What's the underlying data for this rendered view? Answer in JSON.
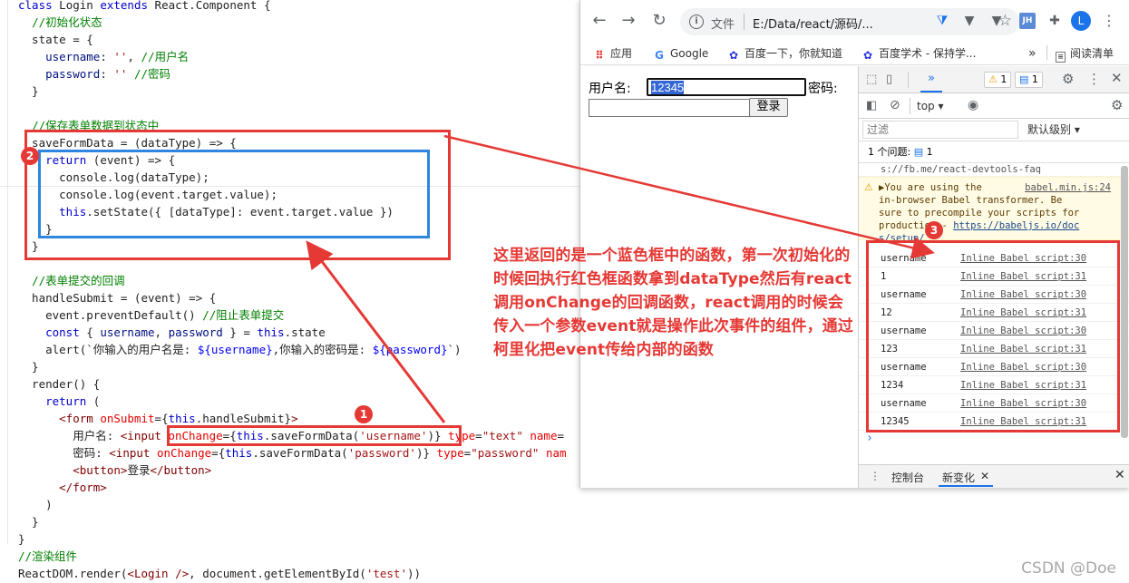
{
  "editor": {
    "lines": [
      {
        "html": "<span class='c-kw'>class</span> Login <span class='c-kw'>extends</span> React.Component {"
      },
      {
        "html": "  <span class='c-cm'>//初始化状态</span>"
      },
      {
        "html": "  state = {"
      },
      {
        "html": "    <span class='c-vr'>username</span>: <span class='c-st'>''</span>, <span class='c-cm'>//用户名</span>"
      },
      {
        "html": "    <span class='c-vr'>password</span>: <span class='c-st'>''</span> <span class='c-cm'>//密码</span>"
      },
      {
        "html": "  }"
      },
      {
        "html": ""
      },
      {
        "html": "  <span class='c-cm'>//保存表单数据到状态中</span>"
      },
      {
        "html": "  saveFormData = (dataType) => {"
      },
      {
        "html": "    <span class='c-kw'>return</span> (event) => {"
      },
      {
        "html": "      console.log(dataType);"
      },
      {
        "html": "      console.log(event.target.value);"
      },
      {
        "html": "      <span class='c-kw'>this</span>.setState({ [dataType]: event.target.value })"
      },
      {
        "html": "    }"
      },
      {
        "html": "  }"
      },
      {
        "html": ""
      },
      {
        "html": "  <span class='c-cm'>//表单提交的回调</span>"
      },
      {
        "html": "  handleSubmit = (event) => {"
      },
      {
        "html": "    event.preventDefault() <span class='c-cm'>//阻止表单提交</span>"
      },
      {
        "html": "    <span class='c-kw'>const</span> { <span class='c-vr'>username</span>, <span class='c-vr'>password</span> } = <span class='c-kw'>this</span>.state"
      },
      {
        "html": "    alert(`你输入的用户名是: <span class='c-bl'>${username}</span>,你输入的密码是: <span class='c-bl'>${password}</span>`)"
      },
      {
        "html": "  }"
      },
      {
        "html": "  render() {"
      },
      {
        "html": "    <span class='c-kw'>return</span> ("
      },
      {
        "html": "      <span class='c-tg'>&lt;form</span> <span class='c-at'>onSubmit</span>={<span class='c-kw'>this</span>.handleSubmit}<span class='c-tg'>&gt;</span>"
      },
      {
        "html": "        用户名: <span class='c-tg'>&lt;input</span> <span class='c-at'>onChange</span>={<span class='c-kw'>this</span>.saveFormData(<span class='c-st'>'username'</span>)} <span class='c-at'>type</span>=<span class='c-st'>\"text\"</span> <span class='c-at'>name</span>="
      },
      {
        "html": "        密码: <span class='c-tg'>&lt;input</span> <span class='c-at'>onChange</span>={<span class='c-kw'>this</span>.saveFormData(<span class='c-st'>'password'</span>)} <span class='c-at'>type</span>=<span class='c-st'>\"password\"</span> <span class='c-at'>nam</span>"
      },
      {
        "html": "        <span class='c-tg'>&lt;button&gt;</span>登录<span class='c-tg'>&lt;/button&gt;</span>"
      },
      {
        "html": "      <span class='c-tg'>&lt;/form&gt;</span>"
      },
      {
        "html": "    )"
      },
      {
        "html": "  }"
      },
      {
        "html": "}"
      },
      {
        "html": "<span class='c-cm'>//渲染组件</span>"
      },
      {
        "html": "ReactDOM.render(<span class='c-tg'>&lt;Login /&gt;</span>, document.getElementById(<span class='c-st'>'test'</span>))"
      }
    ]
  },
  "browser": {
    "omnibox": {
      "label": "文件",
      "url": "E:/Data/react/源码/..."
    },
    "avatar_letter": "L",
    "ext_jh": "JH",
    "bookmarks": {
      "apps": "应用",
      "google": "Google",
      "baidu": "百度一下，你就知道",
      "xueshu": "百度学术 - 保持学...",
      "more": "»",
      "reading": "阅读清单"
    }
  },
  "page": {
    "username_label": "用户名:",
    "username_value": "12345",
    "password_label": "密码:",
    "submit_label": "登录"
  },
  "devtools": {
    "more_tabs": "»",
    "warn_count": "1",
    "msg_count": "1",
    "context": "top",
    "filter_placeholder": "过滤",
    "level": "默认级别",
    "issues": "1 个问题:",
    "issues_count": "1",
    "faq_link": "s://fb.me/react-devtools-faq",
    "warn_src": "babel.min.js:24",
    "warn_lines": [
      "▶You are using the",
      "in-browser Babel transformer. Be",
      "sure to precompile your scripts for",
      "production - "
    ],
    "warn_link": "https://babeljs.io/doc",
    "warn_link2": "s/setup/",
    "logs": [
      {
        "msg": "username",
        "src": "Inline Babel script:30"
      },
      {
        "msg": "1",
        "src": "Inline Babel script:31"
      },
      {
        "msg": "username",
        "src": "Inline Babel script:30"
      },
      {
        "msg": "12",
        "src": "Inline Babel script:31"
      },
      {
        "msg": "username",
        "src": "Inline Babel script:30"
      },
      {
        "msg": "123",
        "src": "Inline Babel script:31"
      },
      {
        "msg": "username",
        "src": "Inline Babel script:30"
      },
      {
        "msg": "1234",
        "src": "Inline Babel script:31"
      },
      {
        "msg": "username",
        "src": "Inline Babel script:30"
      },
      {
        "msg": "12345",
        "src": "Inline Babel script:31"
      }
    ],
    "prompt": "›",
    "drawer_console": "控制台",
    "drawer_new": "新变化"
  },
  "annotations": {
    "circle1": "1",
    "circle2": "2",
    "circle3": "3",
    "note": "这里返回的是一个蓝色框中的函数，第一次初始化的时候回执行红色框函数拿到dataType然后有react调用onChange的回调函数，react调用的时候会传入一个参数event就是操作此次事件的组件，通过柯里化把event传给内部的函数",
    "colors": {
      "red": "#e53935",
      "blue": "#2e86de"
    }
  },
  "watermark": "CSDN @Doe"
}
